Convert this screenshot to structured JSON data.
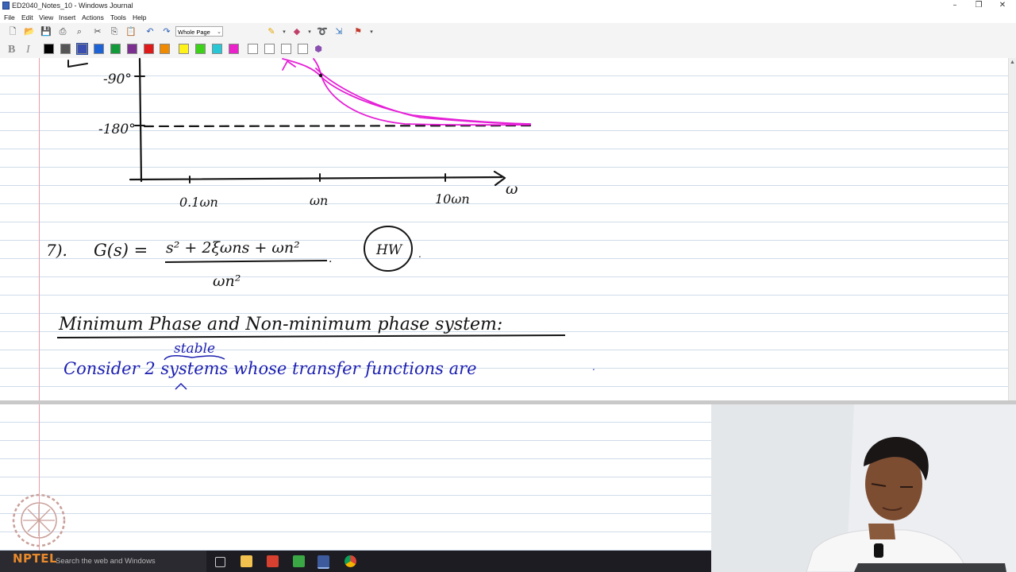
{
  "window": {
    "title": "ED2040_Notes_10 - Windows Journal",
    "controls": [
      "–",
      "❐",
      "✕"
    ]
  },
  "menu": [
    "File",
    "Edit",
    "View",
    "Insert",
    "Actions",
    "Tools",
    "Help"
  ],
  "toolbar": {
    "zoom_value": "Whole Page"
  },
  "format_bar": {
    "bold": "B",
    "italic": "I",
    "pen_colors": [
      "#000000",
      "#555555",
      "#3a4fb0",
      "#1e63d6",
      "#129a3a",
      "#7b2f8e",
      "#e01919",
      "#f08a00",
      "#fff21a",
      "#3ed11a",
      "#27c7d6",
      "#ea22c9",
      "#ffffff",
      "#ffffff",
      "#ffffff",
      "#ffffff"
    ]
  },
  "notes": {
    "ink_colors": {
      "black": "#141414",
      "magenta": "#e51fd6",
      "blue": "#1b1eb0"
    },
    "phase_plot": {
      "y_ticks": [
        "-90°",
        "-180°"
      ],
      "x_ticks": [
        "0.1ωn",
        "ωn",
        "10ωn"
      ],
      "x_label": "ω"
    },
    "problem": {
      "number": "7).",
      "lhs": "G(s) =",
      "numerator": "s² + 2ξωns + ωn²",
      "denominator": "ωn²",
      "tag": "HW"
    },
    "heading": "Minimum Phase and Non-minimum phase system:",
    "sentence": "Consider 2 systems whose transfer functions are",
    "insertion": "stable"
  },
  "taskbar": {
    "search_placeholder": "Search the web and Windows"
  },
  "watermark": {
    "logo_text": "NPTEL"
  }
}
